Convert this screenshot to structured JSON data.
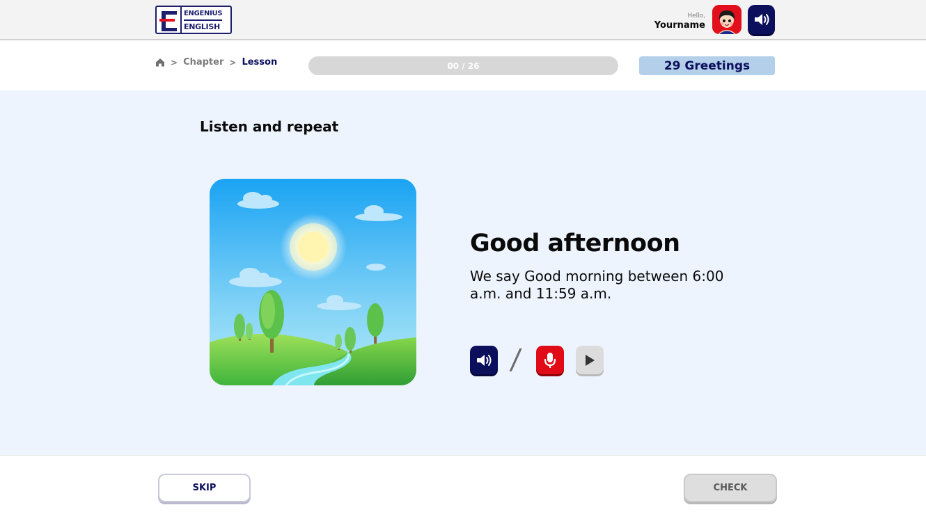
{
  "header": {
    "logo_line1": "ENGENIUS",
    "logo_line2": "ENGLISH",
    "greeting": "Hello,",
    "username": "Yourname",
    "sound_icon": "speaker-icon",
    "avatar_icon": "avatar-face-icon"
  },
  "breadcrumb": {
    "home_icon": "home-icon",
    "separator": ">",
    "chapter": "Chapter",
    "lesson": "Lesson"
  },
  "progress": {
    "label": "00 / 26",
    "current": 0,
    "total": 26
  },
  "lesson_chip": "29 Greetings",
  "main": {
    "instruction": "Listen and repeat",
    "word": "Good afternoon",
    "description": "We say Good morning between 6:00 a.m. and 11:59 a.m.",
    "separator": "/",
    "controls": {
      "listen_icon": "speaker-icon",
      "record_icon": "microphone-icon",
      "play_icon": "play-icon"
    }
  },
  "footer": {
    "skip_label": "SKIP",
    "check_label": "CHECK"
  },
  "colors": {
    "navy": "#0b0f5c",
    "red": "#e10b17",
    "main_bg": "#edf4fd",
    "chip_bg": "#b3cfe9",
    "progress_bg": "#d7d7d7"
  }
}
